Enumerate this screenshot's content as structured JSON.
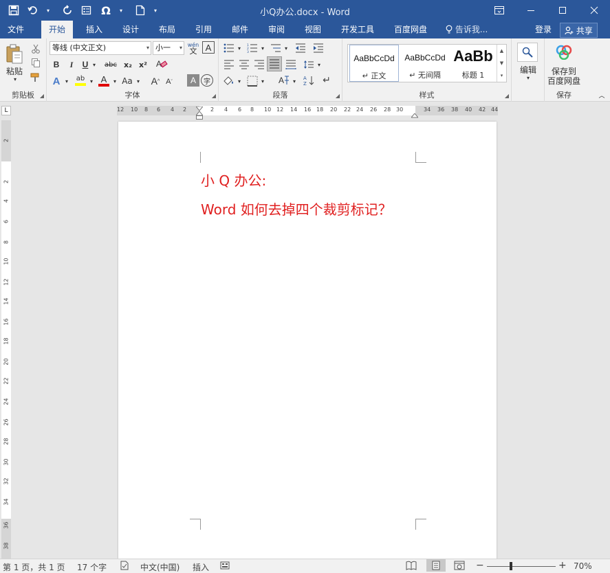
{
  "title_bar": {
    "title": "小Q办公.docx - Word",
    "qat_icons": [
      "save-icon",
      "undo-icon",
      "redo-icon",
      "form-icon",
      "symbol-icon",
      "new-doc-icon",
      "customize-icon"
    ],
    "window_controls": [
      "ribbon-display-icon",
      "minimize-icon",
      "maximize-icon",
      "close-icon"
    ]
  },
  "tabs": [
    {
      "label": "文件"
    },
    {
      "label": "开始"
    },
    {
      "label": "插入"
    },
    {
      "label": "设计"
    },
    {
      "label": "布局"
    },
    {
      "label": "引用"
    },
    {
      "label": "邮件"
    },
    {
      "label": "审阅"
    },
    {
      "label": "视图"
    },
    {
      "label": "开发工具"
    },
    {
      "label": "百度网盘"
    }
  ],
  "active_tab": "开始",
  "tell_me": "告诉我...",
  "login": "登录",
  "share": "共享",
  "ribbon": {
    "clipboard": {
      "paste_label": "粘贴",
      "group_label": "剪贴板"
    },
    "font": {
      "font_name": "等线 (中文正文)",
      "font_size": "小一",
      "phonetic": "wén",
      "phonetic_char": "文",
      "border_char": "A",
      "bold": "B",
      "italic": "I",
      "underline": "U",
      "strike": "abc",
      "subscript": "x₂",
      "superscript": "x²",
      "text_effect": "A",
      "highlight": "ab",
      "font_color": "A",
      "change_case": "Aa",
      "grow": "A",
      "shrink": "A",
      "char_shading": "A",
      "enclose": "字",
      "group_label": "字体"
    },
    "paragraph": {
      "group_label": "段落"
    },
    "styles": {
      "items": [
        {
          "preview": "AaBbCcDd",
          "name": "↵ 正文"
        },
        {
          "preview": "AaBbCcDd",
          "name": "↵ 无间隔"
        },
        {
          "preview": "AaBb",
          "name": "标题 1"
        }
      ],
      "group_label": "样式"
    },
    "editing": {
      "label": "编辑"
    },
    "save": {
      "label_line1": "保存到",
      "label_line2": "百度网盘",
      "group_label": "保存"
    }
  },
  "ruler": {
    "h_labels": [
      "12",
      "10",
      "8",
      "6",
      "4",
      "2",
      "2",
      "4",
      "6",
      "8",
      "10",
      "12",
      "14",
      "16",
      "18",
      "20",
      "22",
      "24",
      "26",
      "28",
      "30",
      "34",
      "36",
      "38",
      "40",
      "42",
      "44"
    ],
    "v_labels": [
      "2",
      "2",
      "4",
      "6",
      "8",
      "10",
      "12",
      "14",
      "16",
      "18",
      "20",
      "22",
      "24",
      "26",
      "28",
      "30",
      "32",
      "34",
      "36",
      "38"
    ],
    "tab_selector": "L"
  },
  "document": {
    "line1": "小 Q 办公:",
    "line2": "Word 如何去掉四个裁剪标记？",
    "text_color": "#e02020"
  },
  "status_bar": {
    "page": "第 1 页，共 1 页",
    "words": "17 个字",
    "language": "中文(中国)",
    "mode": "插入",
    "zoom": "70%"
  },
  "colors": {
    "accent": "#2b579a",
    "highlight_bar": "#ffff00",
    "font_color_bar": "#e00000"
  }
}
